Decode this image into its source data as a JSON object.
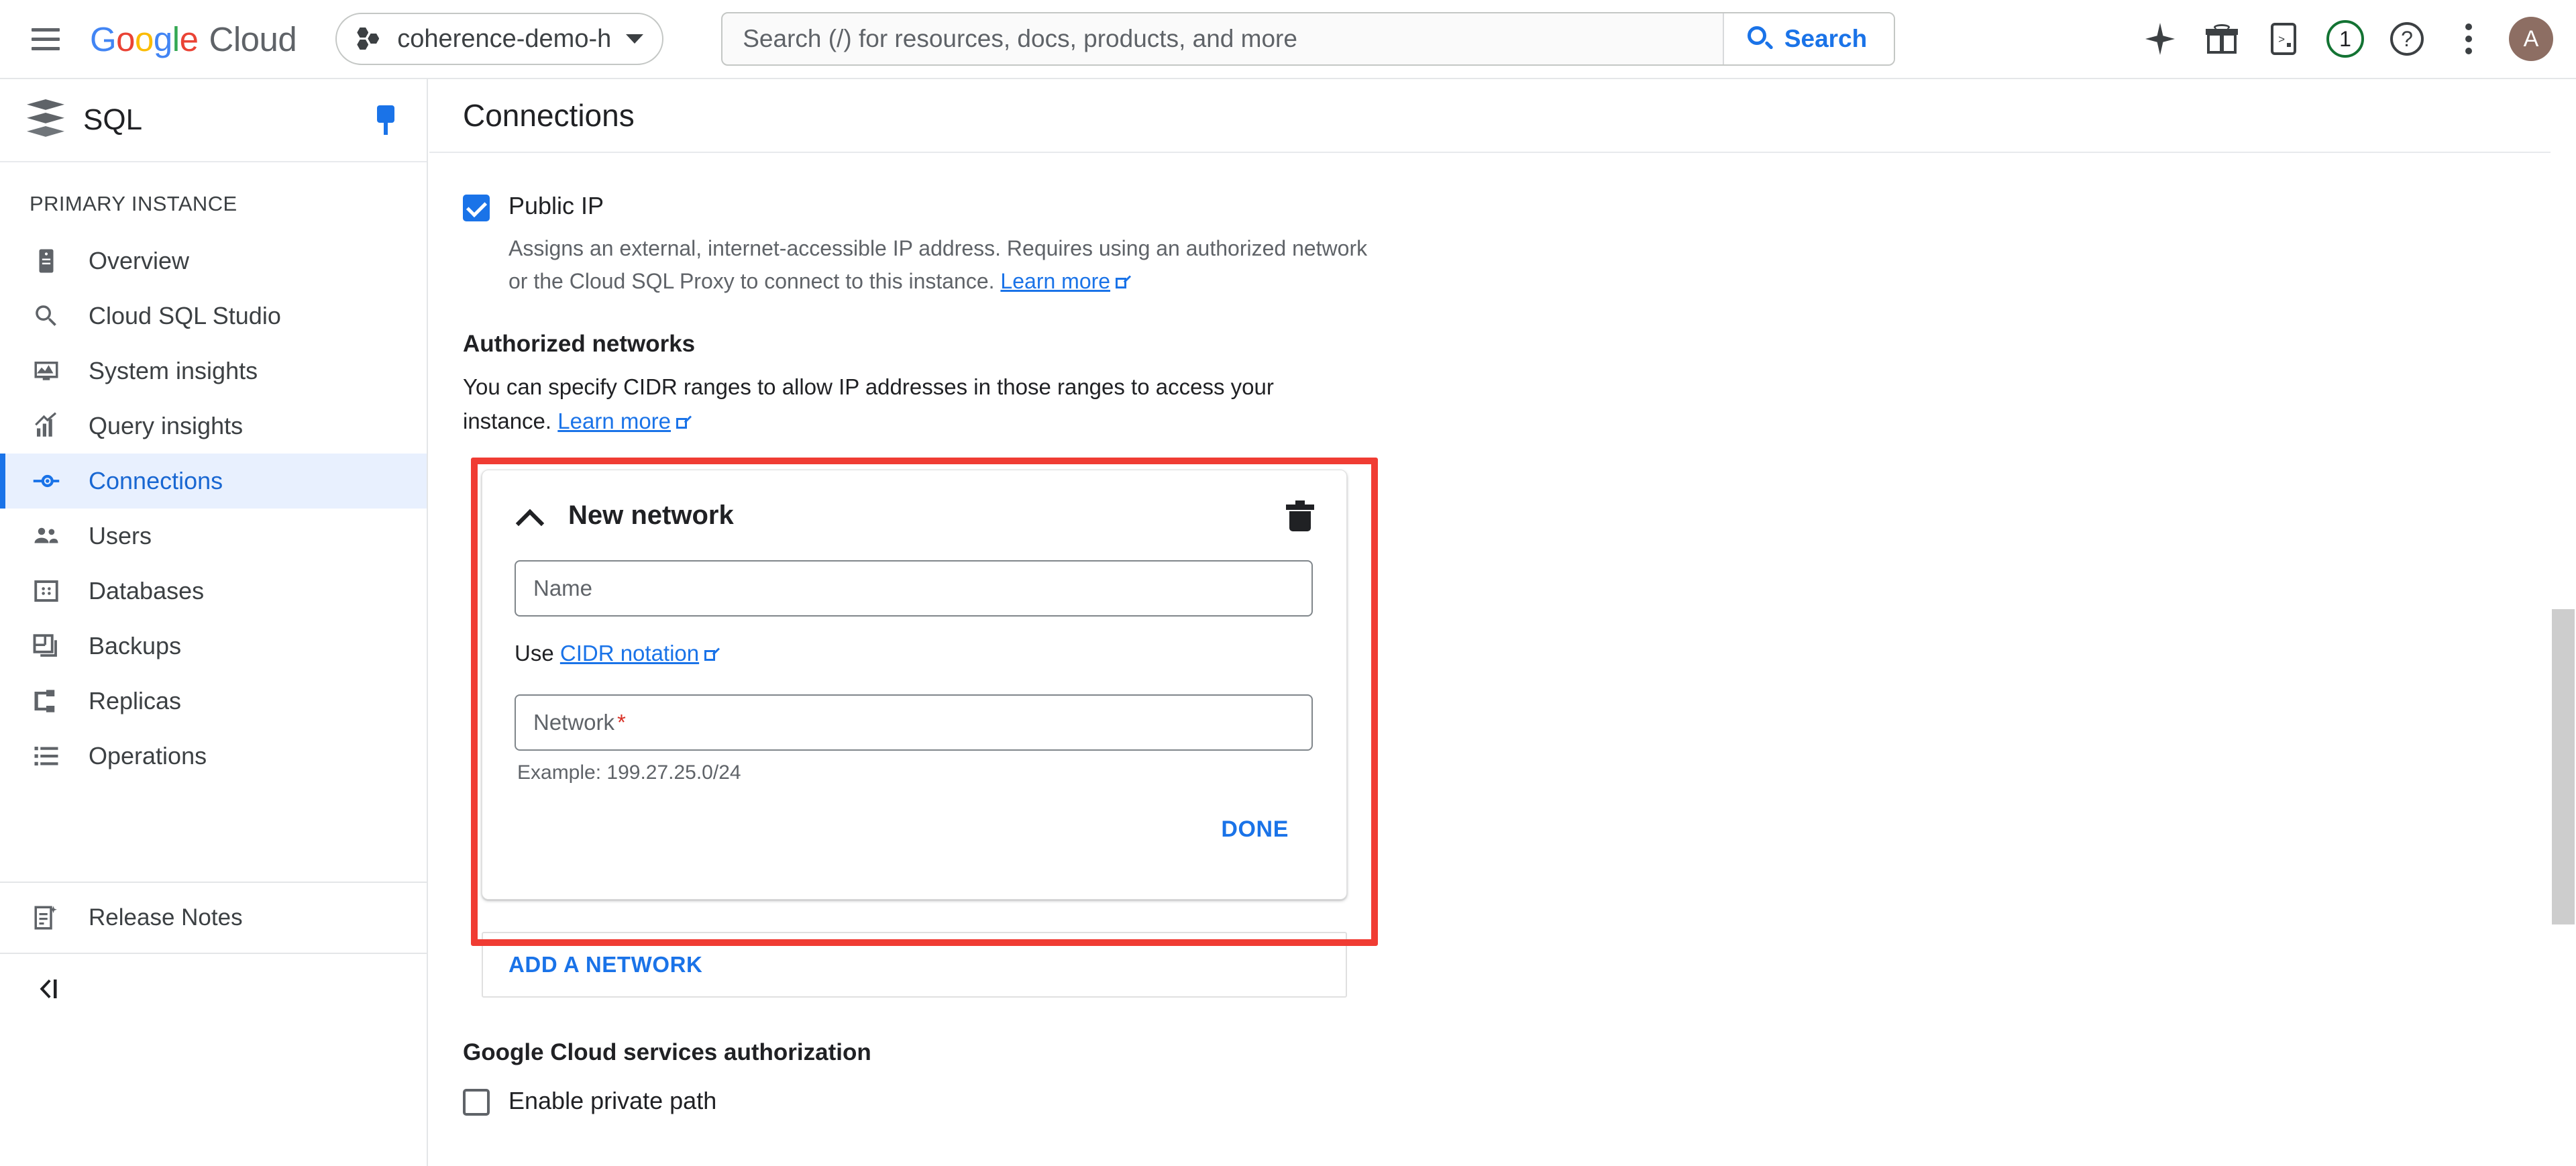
{
  "header": {
    "menu_icon": "hamburger-icon",
    "brand": {
      "google": "Google",
      "cloud": "Cloud"
    },
    "project": {
      "name": "coherence-demo-h",
      "icon": "project-hex-icon"
    },
    "search": {
      "placeholder": "Search (/) for resources, docs, products, and more",
      "value": "",
      "button_label": "Search"
    },
    "icons": [
      {
        "name": "gemini-spark-icon",
        "label": ""
      },
      {
        "name": "gift-icon",
        "label": ""
      },
      {
        "name": "cloud-shell-icon",
        "label": ""
      },
      {
        "name": "notifications-badge",
        "label": "1"
      },
      {
        "name": "help-icon",
        "label": "?"
      },
      {
        "name": "more-options-icon",
        "label": ""
      }
    ],
    "avatar_initial": "A"
  },
  "sidebar": {
    "product_title": "SQL",
    "pin_icon": "pin-icon",
    "section_label": "PRIMARY INSTANCE",
    "items": [
      {
        "label": "Overview",
        "icon": "instance-icon",
        "active": false
      },
      {
        "label": "Cloud SQL Studio",
        "icon": "search-icon",
        "active": false
      },
      {
        "label": "System insights",
        "icon": "monitor-insights-icon",
        "active": false
      },
      {
        "label": "Query insights",
        "icon": "query-insights-icon",
        "active": false
      },
      {
        "label": "Connections",
        "icon": "connections-icon",
        "active": true
      },
      {
        "label": "Users",
        "icon": "users-icon",
        "active": false
      },
      {
        "label": "Databases",
        "icon": "databases-icon",
        "active": false
      },
      {
        "label": "Backups",
        "icon": "backups-icon",
        "active": false
      },
      {
        "label": "Replicas",
        "icon": "replicas-icon",
        "active": false
      },
      {
        "label": "Operations",
        "icon": "operations-icon",
        "active": false
      }
    ],
    "release_notes": {
      "label": "Release Notes",
      "icon": "release-notes-icon"
    },
    "collapse_icon": "collapse-panel-icon"
  },
  "main": {
    "page_title": "Connections",
    "public_ip": {
      "checkbox_label": "Public IP",
      "checked": true,
      "description": "Assigns an external, internet-accessible IP address. Requires using an authorized network or the Cloud SQL Proxy to connect to this instance.",
      "learn_more": "Learn more"
    },
    "authorized_networks": {
      "title": "Authorized networks",
      "description": "You can specify CIDR ranges to allow IP addresses in those ranges to access your instance.",
      "learn_more": "Learn more"
    },
    "new_network_card": {
      "highlighted": true,
      "highlight_color": "#f03c33",
      "expand_icon": "chevron-up-icon",
      "title": "New network",
      "delete_icon": "trash-icon",
      "name_field": {
        "placeholder": "Name",
        "value": ""
      },
      "cidr_prefix": "Use",
      "cidr_link": "CIDR notation",
      "network_field": {
        "placeholder": "Network",
        "value": "",
        "required_marker": "*"
      },
      "example": "Example: 199.27.25.0/24",
      "done_label": "DONE"
    },
    "add_network_label": "ADD A NETWORK",
    "gcs_auth": {
      "title": "Google Cloud services authorization",
      "checkbox_label": "Enable private path",
      "checked": false
    }
  },
  "colors": {
    "accent_blue": "#1a73e8",
    "active_bg": "#e8f0fe",
    "highlight_red": "#f03c33",
    "required_red": "#d93025",
    "avatar_bg": "#8d6e63",
    "badge_green": "#137333"
  }
}
